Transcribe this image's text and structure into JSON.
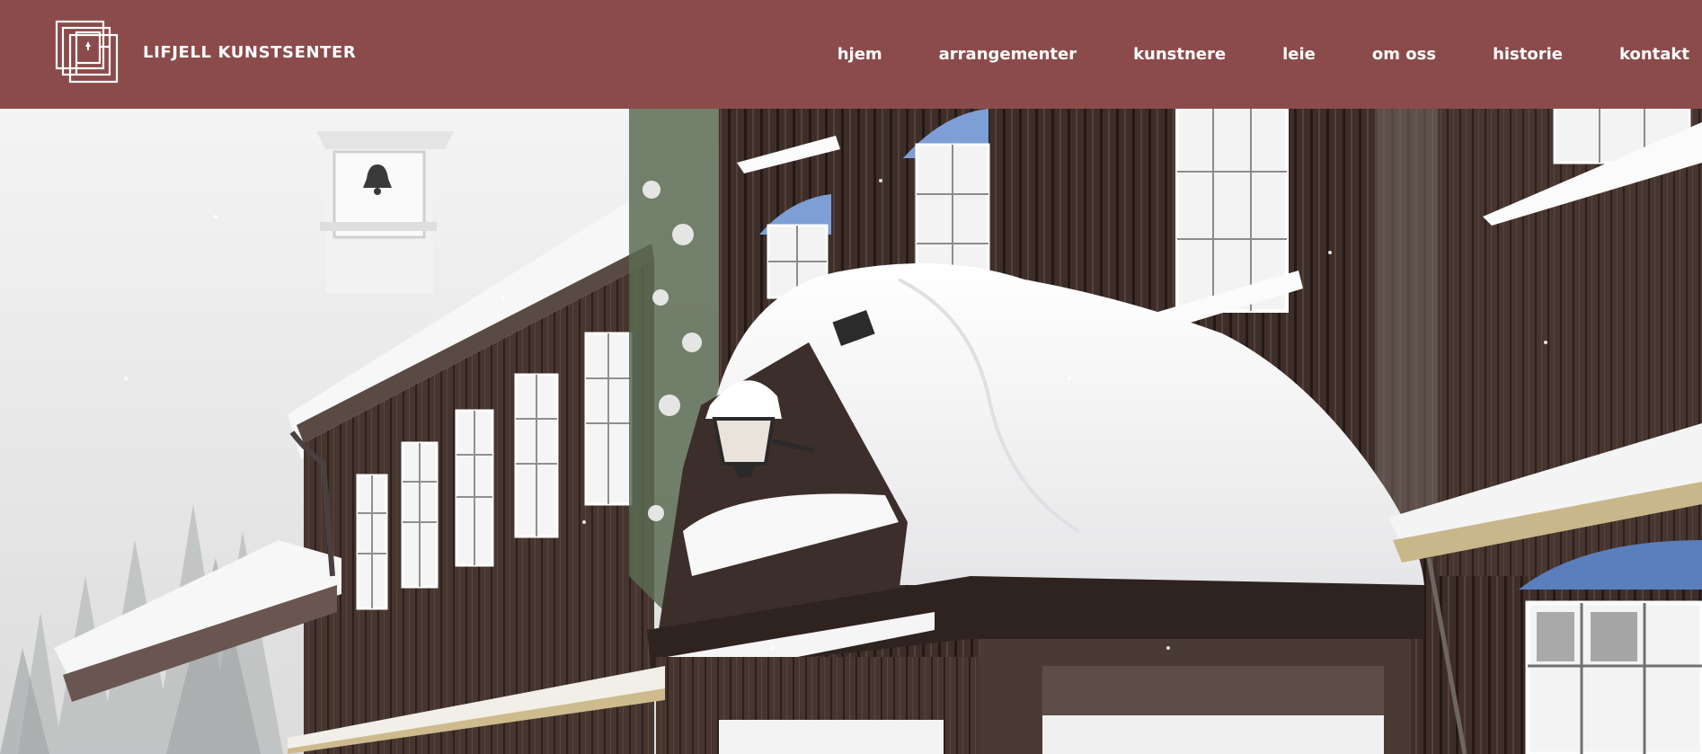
{
  "site": {
    "name": "LIFJELL KUNSTSENTER",
    "logo_icon": "lifjell-logo-icon"
  },
  "nav": {
    "items": [
      {
        "label": "hjem"
      },
      {
        "label": "arrangementer"
      },
      {
        "label": "kunstnere"
      },
      {
        "label": "leie"
      },
      {
        "label": "om oss"
      },
      {
        "label": "historie"
      },
      {
        "label": "kontakt"
      }
    ]
  },
  "hero": {
    "image": "snowy-wooden-building-photo"
  },
  "colors": {
    "header_bg": "#8b4b4b",
    "header_text": "#ffffff"
  }
}
